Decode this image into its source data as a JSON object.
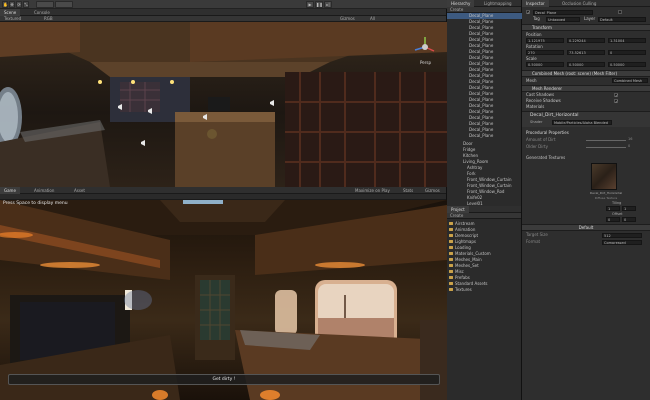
{
  "toolbar": {
    "layers_label": "Layers",
    "layout_label": "Layout"
  },
  "scene_panel": {
    "tab_scene": "Scene",
    "tab_console": "Console",
    "draw_mode": "Textured",
    "rgb": "RGB",
    "gizmos": "Gizmos",
    "search_all": "All",
    "persp_label": "Persp"
  },
  "game_panel": {
    "tab_game": "Game",
    "tab_animation": "Animation",
    "tab_asset": "Asset",
    "maximize_label": "Maximize on Play",
    "stats_label": "Stats",
    "gizmos_label": "Gizmos",
    "hint_text": "Press Space to display menu",
    "button_text": "Get dirty !"
  },
  "hierarchy": {
    "tab_hierarchy": "Hierarchy",
    "tab_lightmapping": "Lightmapping",
    "create_label": "Create",
    "items": [
      "Decal_Plane",
      "Decal_Plane",
      "Decal_Plane",
      "Decal_Plane",
      "Decal_Plane",
      "Decal_Plane",
      "Decal_Plane",
      "Decal_Plane",
      "Decal_Plane",
      "Decal_Plane",
      "Decal_Plane",
      "Decal_Plane",
      "Decal_Plane",
      "Decal_Plane",
      "Decal_Plane",
      "Decal_Plane",
      "Decal_Plane",
      "Decal_Plane",
      "Decal_Plane",
      "Decal_Plane",
      "Decal_Plane"
    ],
    "tree_items": [
      "Door",
      "Fridge",
      "Kitchen",
      "Living_Room",
      "Ashtray",
      "Fork",
      "Front_Window_Curtain",
      "Front_Window_Curtain",
      "Front_Window_Rod",
      "Knife02",
      "Level01"
    ]
  },
  "project": {
    "tab_project": "Project",
    "create_label": "Create",
    "folders": [
      "Airstream",
      "Animation",
      "Demoscript",
      "Lightmaps",
      "Loading",
      "Materials_Custom",
      "Meshes_Main",
      "Meshes_Set",
      "Misc",
      "Prefabs",
      "Standard Assets",
      "Textures"
    ]
  },
  "inspector": {
    "tab_inspector": "Inspector",
    "tab_occlusion": "Occlusion Culling",
    "object_name": "Decal_Plane",
    "tag_label": "Tag",
    "tag_value": "Untagged",
    "layer_label": "Layer",
    "layer_value": "Default",
    "transform_title": "Transform",
    "position_label": "Position",
    "rotation_label": "Rotation",
    "scale_label": "Scale",
    "pos_x": "1.121975",
    "pos_y": "0.229244",
    "pos_z": "1.31004",
    "rot_x": "270",
    "rot_y": "73.52613",
    "rot_z": "0",
    "scale_x": "0.50000",
    "scale_y": "0.50000",
    "scale_z": "0.50000",
    "mesh_filter_title": "Combined Mesh (root: scene) (Mesh Filter)",
    "mesh_label": "Mesh",
    "mesh_value": "Combined Mesh",
    "renderer_title": "Mesh Renderer",
    "cast_shadows": "Cast Shadows",
    "receive_shadows": "Receive Shadows",
    "materials_label": "Materials",
    "material_title": "Decal_Dirt_Horizontal",
    "shader_label": "Shader",
    "shader_value": "Mobile/Particles/Alpha Blended",
    "procedural_title": "Procedural Properties",
    "amount_label": "Amount of Dirt",
    "amount_value": "16",
    "dirty_label": "Older Dirty",
    "dirty_value": "0",
    "textures_title": "Generated Textures",
    "texture_name": "Decal_Dirt_Horizontal",
    "texture_sub": "Diffuse Texture",
    "tiling_label": "Tiling",
    "offset_label": "Offset",
    "tiling_x": "1",
    "tiling_y": "1",
    "offset_x": "0",
    "offset_y": "0",
    "default_label": "Default",
    "target_label": "Target Size",
    "target_value": "512",
    "format_label": "Format",
    "format_value": "Compressed"
  }
}
